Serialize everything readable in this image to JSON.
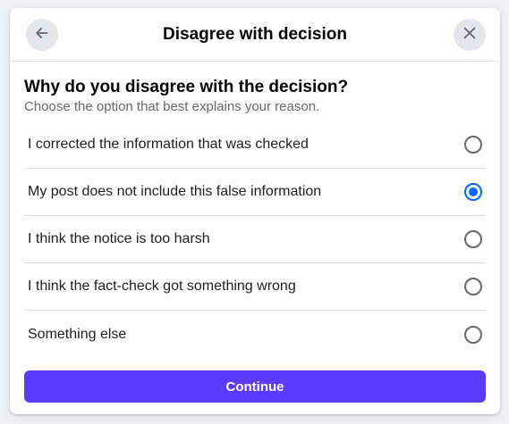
{
  "dialog": {
    "title": "Disagree with decision",
    "back_icon": "arrow-left-icon",
    "close_icon": "close-icon"
  },
  "question": {
    "heading": "Why do you disagree with the decision?",
    "subheading": "Choose the option that best explains your reason."
  },
  "options": [
    {
      "label": "I corrected the information that was checked",
      "selected": false
    },
    {
      "label": "My post does not include this false information",
      "selected": true
    },
    {
      "label": "I think the notice is too harsh",
      "selected": false
    },
    {
      "label": "I think the fact-check got something wrong",
      "selected": false
    },
    {
      "label": "Something else",
      "selected": false
    }
  ],
  "footer": {
    "continue_label": "Continue"
  },
  "colors": {
    "accent": "#5b3cff",
    "radio_selected": "#0866ff"
  }
}
